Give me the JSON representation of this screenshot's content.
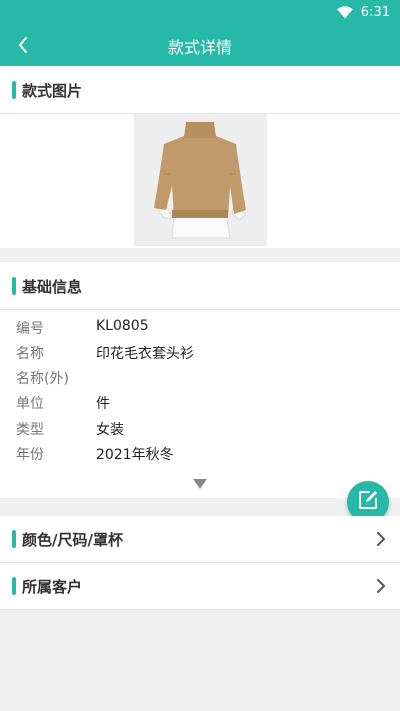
{
  "status_bar": {
    "time": "6:31"
  },
  "app_bar": {
    "title": "款式详情"
  },
  "sections": {
    "image": {
      "title": "款式图片"
    },
    "basic_info": {
      "title": "基础信息"
    }
  },
  "basic_info": {
    "rows": [
      {
        "label": "编号",
        "value": "KL0805"
      },
      {
        "label": "名称",
        "value": "印花毛衣套头衫"
      },
      {
        "label": "名称(外)",
        "value": ""
      },
      {
        "label": "单位",
        "value": "件"
      },
      {
        "label": "类型",
        "value": "女装"
      },
      {
        "label": "年份",
        "value": "2021年秋冬"
      }
    ]
  },
  "nav": {
    "items": [
      {
        "label": "颜色/尺码/罩杯"
      },
      {
        "label": "所属客户"
      }
    ]
  },
  "colors": {
    "accent": "#26b9a7",
    "background": "#f0f0f0"
  },
  "icons": {
    "back": "back-arrow-icon",
    "wifi": "wifi-icon",
    "edit": "edit-icon",
    "expand": "caret-down-icon",
    "chevron": "chevron-right-icon"
  }
}
